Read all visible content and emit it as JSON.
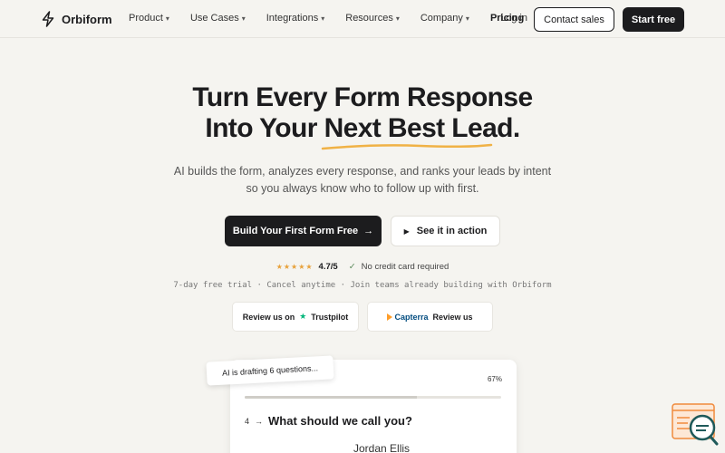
{
  "brand": {
    "name": "Orbiform"
  },
  "nav": {
    "items": [
      {
        "label": "Product",
        "has_dropdown": true
      },
      {
        "label": "Use Cases",
        "has_dropdown": true
      },
      {
        "label": "Integrations",
        "has_dropdown": true
      },
      {
        "label": "Resources",
        "has_dropdown": true
      },
      {
        "label": "Company",
        "has_dropdown": true
      },
      {
        "label": "Pricing",
        "has_dropdown": false
      }
    ],
    "login": "Log in",
    "contact": "Contact sales",
    "start": "Start free"
  },
  "hero": {
    "headline_line1": "Turn Every Form Response",
    "headline_line2_a": "Into Your ",
    "headline_line2_b": "Next Best Lead.",
    "subhead_line1": "AI builds the form, analyzes every response, and ranks your leads by intent",
    "subhead_line2": "so you always know who to follow up with first.",
    "primary_cta": "Build Your First Form Free",
    "primary_cta_arrow": "→",
    "secondary_cta": "See it in action",
    "stars": "★★★★★",
    "rating": "4.7/5",
    "check": "✓",
    "no_card": "No credit card required",
    "trial_line": "7-day free trial · Cancel anytime · Join teams already building with Orbiform"
  },
  "reviews": {
    "trustpilot_prefix": "Review us on",
    "trustpilot_name": "Trustpilot",
    "capterra_name": "Capterra",
    "capterra_suffix": "Review us"
  },
  "preview": {
    "ai_tag": "AI is drafting 6 questions...",
    "progress_label": "67%",
    "progress_value": 0.67,
    "question_number": "4",
    "question_arrow": "→",
    "question_text": "What should we call you?",
    "answer": "Jordan Ellis"
  },
  "colors": {
    "background": "#f5f4f0",
    "ink": "#1c1c1e",
    "accent_underline": "#f0b246",
    "trustpilot": "#00b67a",
    "capterra": "#044d80",
    "chat_widget": "#f08a3c"
  },
  "icons": {
    "logo": "bolt-icon",
    "play": "play-icon",
    "chat": "chat-support-icon"
  }
}
